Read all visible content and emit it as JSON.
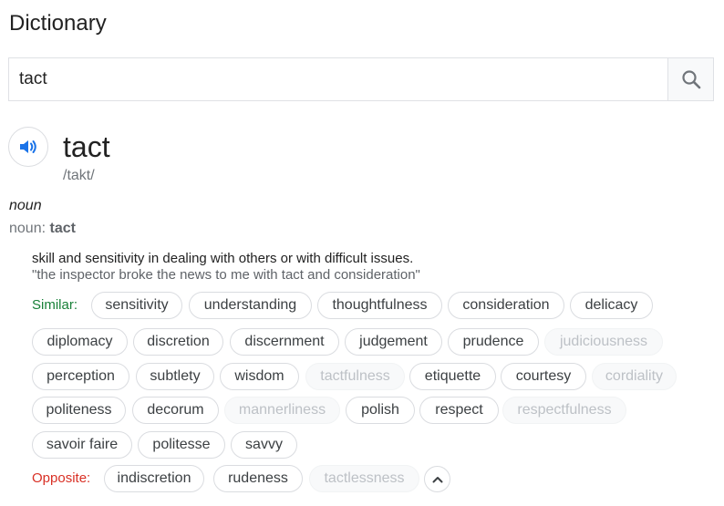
{
  "header": {
    "title": "Dictionary"
  },
  "search": {
    "value": "tact",
    "icon": "search-icon"
  },
  "entry": {
    "word": "tact",
    "phonetic": "/takt/",
    "part_of_speech": "noun",
    "noun_label": "noun: ",
    "noun_word": "tact",
    "definition": "skill and sensitivity in dealing with others or with difficult issues.",
    "example": "\"the inspector broke the news to me with tact and consideration\""
  },
  "similar": {
    "label": "Similar:",
    "chips": [
      {
        "text": "sensitivity",
        "dim": false
      },
      {
        "text": "understanding",
        "dim": false
      },
      {
        "text": "thoughtfulness",
        "dim": false
      },
      {
        "text": "consideration",
        "dim": false
      },
      {
        "text": "delicacy",
        "dim": false
      },
      {
        "text": "diplomacy",
        "dim": false
      },
      {
        "text": "discretion",
        "dim": false
      },
      {
        "text": "discernment",
        "dim": false
      },
      {
        "text": "judgement",
        "dim": false
      },
      {
        "text": "prudence",
        "dim": false
      },
      {
        "text": "judiciousness",
        "dim": true
      },
      {
        "text": "perception",
        "dim": false
      },
      {
        "text": "subtlety",
        "dim": false
      },
      {
        "text": "wisdom",
        "dim": false
      },
      {
        "text": "tactfulness",
        "dim": true
      },
      {
        "text": "etiquette",
        "dim": false
      },
      {
        "text": "courtesy",
        "dim": false
      },
      {
        "text": "cordiality",
        "dim": true
      },
      {
        "text": "politeness",
        "dim": false
      },
      {
        "text": "decorum",
        "dim": false
      },
      {
        "text": "mannerliness",
        "dim": true
      },
      {
        "text": "polish",
        "dim": false
      },
      {
        "text": "respect",
        "dim": false
      },
      {
        "text": "respectfulness",
        "dim": true
      },
      {
        "text": "savoir faire",
        "dim": false
      },
      {
        "text": "politesse",
        "dim": false
      },
      {
        "text": "savvy",
        "dim": false
      }
    ]
  },
  "opposite": {
    "label": "Opposite:",
    "chips": [
      {
        "text": "indiscretion",
        "dim": false
      },
      {
        "text": "rudeness",
        "dim": false
      },
      {
        "text": "tactlessness",
        "dim": true
      }
    ]
  },
  "colors": {
    "similar": "#188038",
    "opposite": "#d93025",
    "accent": "#1a73e8"
  },
  "icons": {
    "speaker": "speaker-icon",
    "expand": "chevron-up-icon"
  }
}
